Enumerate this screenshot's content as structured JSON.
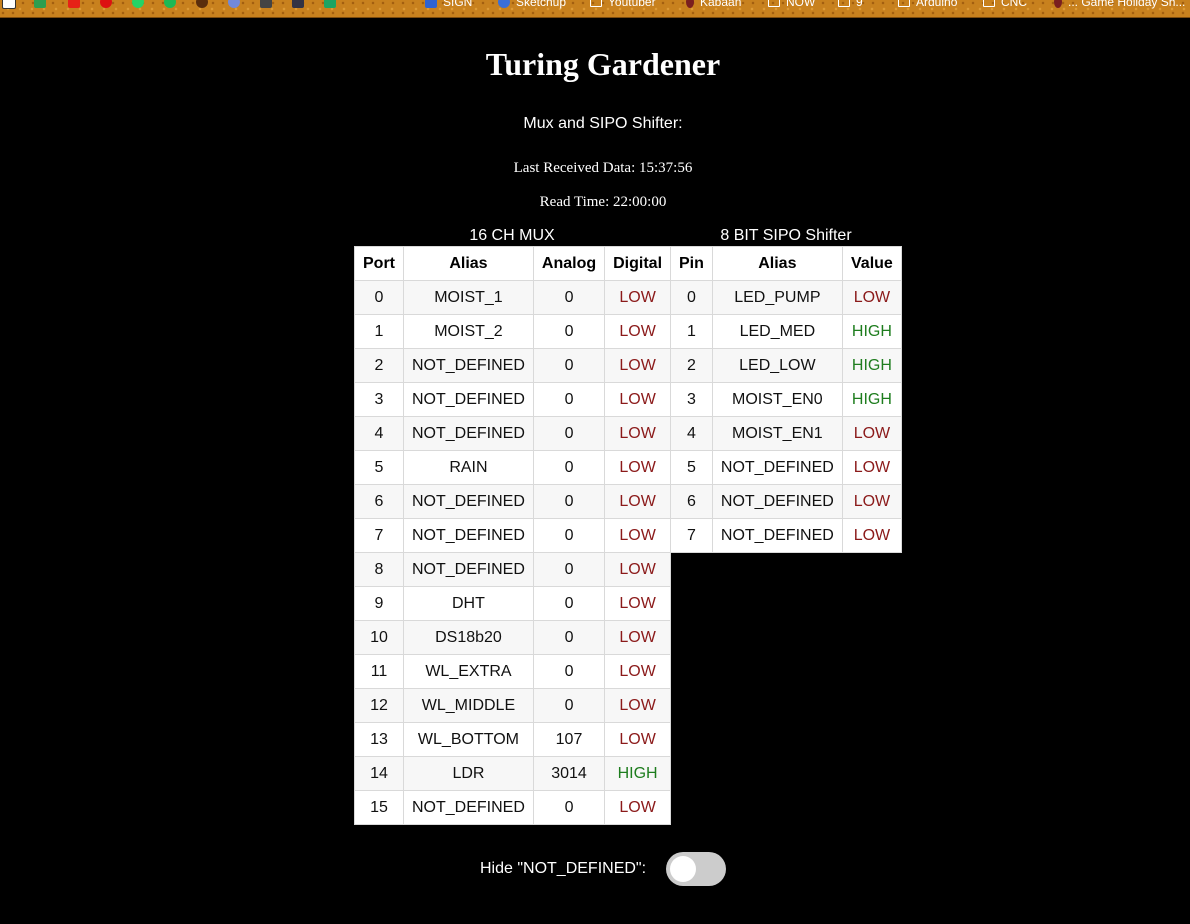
{
  "page": {
    "title": "Turing Gardener",
    "subtitle": "Mux and SIPO Shifter:",
    "last_received_label": "Last Received Data: 15:37:56",
    "read_time_label": "Read Time: 22:00:00"
  },
  "bookmarks": [
    {
      "label": "SIGN",
      "icon": "blue-square-icon",
      "color": "#2f63d1"
    },
    {
      "label": "Sketchup",
      "icon": "sketchup-icon",
      "color": "#3b6fd8"
    },
    {
      "label": "Youtuber",
      "icon": "folder-icon"
    },
    {
      "label": "Kabaan",
      "icon": "pin-icon",
      "color": "#7a1f1f"
    },
    {
      "label": "NOW",
      "icon": "folder-icon"
    },
    {
      "label": "9",
      "icon": "folder-icon"
    },
    {
      "label": "Arduino",
      "icon": "folder-icon"
    },
    {
      "label": "CNC",
      "icon": "folder-icon"
    },
    {
      "label": "... Game Holiday Sh...",
      "icon": "pin-icon",
      "color": "#7a1f1f"
    }
  ],
  "mux": {
    "caption": "16 CH MUX",
    "headers": [
      "Port",
      "Alias",
      "Analog",
      "Digital"
    ],
    "rows": [
      {
        "port": "0",
        "alias": "MOIST_1",
        "analog": "0",
        "digital": "LOW"
      },
      {
        "port": "1",
        "alias": "MOIST_2",
        "analog": "0",
        "digital": "LOW"
      },
      {
        "port": "2",
        "alias": "NOT_DEFINED",
        "analog": "0",
        "digital": "LOW"
      },
      {
        "port": "3",
        "alias": "NOT_DEFINED",
        "analog": "0",
        "digital": "LOW"
      },
      {
        "port": "4",
        "alias": "NOT_DEFINED",
        "analog": "0",
        "digital": "LOW"
      },
      {
        "port": "5",
        "alias": "RAIN",
        "analog": "0",
        "digital": "LOW"
      },
      {
        "port": "6",
        "alias": "NOT_DEFINED",
        "analog": "0",
        "digital": "LOW"
      },
      {
        "port": "7",
        "alias": "NOT_DEFINED",
        "analog": "0",
        "digital": "LOW"
      },
      {
        "port": "8",
        "alias": "NOT_DEFINED",
        "analog": "0",
        "digital": "LOW"
      },
      {
        "port": "9",
        "alias": "DHT",
        "analog": "0",
        "digital": "LOW"
      },
      {
        "port": "10",
        "alias": "DS18b20",
        "analog": "0",
        "digital": "LOW"
      },
      {
        "port": "11",
        "alias": "WL_EXTRA",
        "analog": "0",
        "digital": "LOW"
      },
      {
        "port": "12",
        "alias": "WL_MIDDLE",
        "analog": "0",
        "digital": "LOW"
      },
      {
        "port": "13",
        "alias": "WL_BOTTOM",
        "analog": "107",
        "digital": "LOW"
      },
      {
        "port": "14",
        "alias": "LDR",
        "analog": "3014",
        "digital": "HIGH"
      },
      {
        "port": "15",
        "alias": "NOT_DEFINED",
        "analog": "0",
        "digital": "LOW"
      }
    ]
  },
  "sipo": {
    "caption": "8 BIT SIPO Shifter",
    "headers": [
      "Pin",
      "Alias",
      "Value"
    ],
    "rows": [
      {
        "pin": "0",
        "alias": "LED_PUMP",
        "value": "LOW"
      },
      {
        "pin": "1",
        "alias": "LED_MED",
        "value": "HIGH"
      },
      {
        "pin": "2",
        "alias": "LED_LOW",
        "value": "HIGH"
      },
      {
        "pin": "3",
        "alias": "MOIST_EN0",
        "value": "HIGH"
      },
      {
        "pin": "4",
        "alias": "MOIST_EN1",
        "value": "LOW"
      },
      {
        "pin": "5",
        "alias": "NOT_DEFINED",
        "value": "LOW"
      },
      {
        "pin": "6",
        "alias": "NOT_DEFINED",
        "value": "LOW"
      },
      {
        "pin": "7",
        "alias": "NOT_DEFINED",
        "value": "LOW"
      }
    ]
  },
  "toggle": {
    "label": "Hide \"NOT_DEFINED\":",
    "checked": false
  },
  "colors": {
    "low": "#8b1a1a",
    "high": "#1e7d1e",
    "background": "#000000",
    "bookmark_bar": "#c8811e"
  }
}
